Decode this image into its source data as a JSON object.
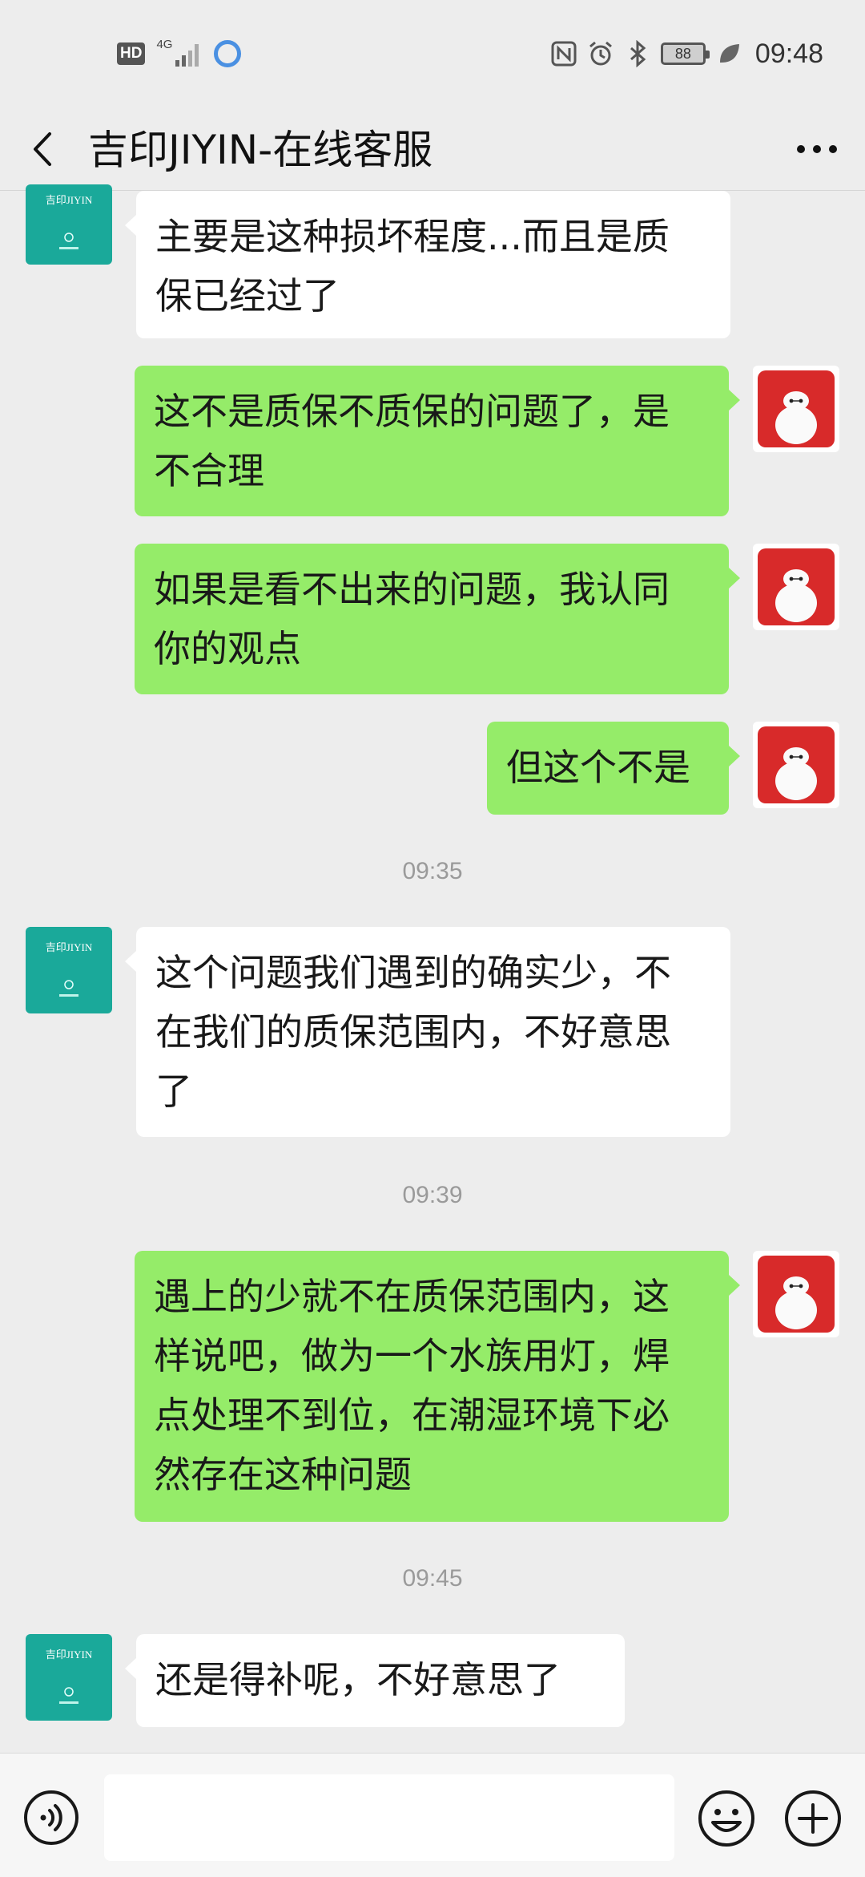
{
  "status_bar": {
    "hd_badge": "HD",
    "network_label": "4G",
    "battery_level": "88",
    "time": "09:48"
  },
  "nav": {
    "title": "吉印JIYIN-在线客服"
  },
  "other_avatar": {
    "logo_text": "吉印JIYIN"
  },
  "messages": [
    {
      "side": "other",
      "lines": [
        "主要是这种损坏程度...而且是质",
        "保已经过了"
      ]
    },
    {
      "side": "self",
      "lines": [
        "这不是质保不质保的问题了，是",
        "不合理"
      ]
    },
    {
      "side": "self",
      "lines": [
        "如果是看不出来的问题，我认同",
        "你的观点"
      ]
    },
    {
      "side": "self",
      "lines": [
        "但这个不是"
      ]
    },
    {
      "side": "time",
      "text": "09:35"
    },
    {
      "side": "other",
      "lines": [
        "这个问题我们遇到的确实少，不",
        "在我们的质保范围内，不好意思",
        "了"
      ]
    },
    {
      "side": "time",
      "text": "09:39"
    },
    {
      "side": "self",
      "lines": [
        "遇上的少就不在质保范围内，这",
        "样说吧，做为一个水族用灯，焊",
        "点处理不到位，在潮湿环境下必",
        "然存在这种问题"
      ]
    },
    {
      "side": "time",
      "text": "09:45"
    },
    {
      "side": "other",
      "lines": [
        "还是得补呢，不好意思了"
      ]
    }
  ],
  "input": {
    "value": "",
    "placeholder": ""
  },
  "colors": {
    "background": "#ededed",
    "self_bubble": "#95ec69",
    "other_bubble": "#ffffff",
    "brand_teal": "#1aa99a",
    "self_avatar_red": "#d82a2a"
  },
  "icons": [
    "back-arrow-icon",
    "more-icon",
    "nfc-icon",
    "alarm-icon",
    "bluetooth-icon",
    "leaf-icon",
    "voice-icon",
    "emoji-icon",
    "plus-icon"
  ]
}
